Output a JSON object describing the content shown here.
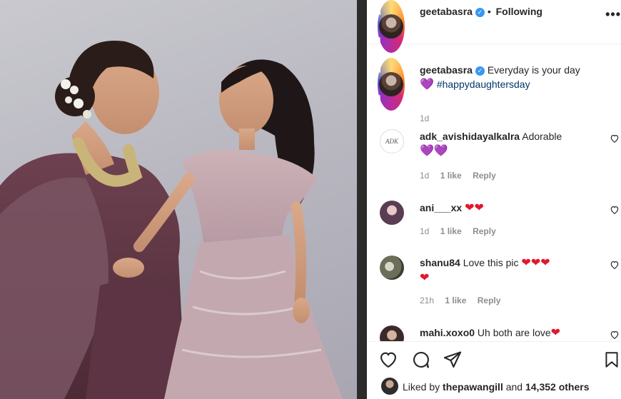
{
  "post": {
    "author": "geetabasra",
    "follow_status": "Following",
    "more_label": "•••",
    "bullet": "•",
    "verified_mark": "✓"
  },
  "caption": {
    "author": "geetabasra",
    "text": "Everyday is your day",
    "hashtag": "#happydaughtersday",
    "time": "1d",
    "emoji": "💜"
  },
  "comments": [
    {
      "author": "adk_avishidayalkalra",
      "text": "Adorable",
      "emoji": "💜💜",
      "time": "1d",
      "likes": "1 like",
      "reply": "Reply",
      "avatar_text": "ADK"
    },
    {
      "author": "ani___xx",
      "text": "",
      "emoji": "❤❤",
      "time": "1d",
      "likes": "1 like",
      "reply": "Reply"
    },
    {
      "author": "shanu84",
      "text": "Love this pic",
      "emoji": "❤❤❤",
      "emoji2": "❤",
      "time": "21h",
      "likes": "1 like",
      "reply": "Reply"
    },
    {
      "author": "mahi.xoxo0",
      "text": "Uh both are love",
      "emoji": "❤"
    }
  ],
  "likes": {
    "prefix": "Liked by",
    "user": "thepawangill",
    "and": "and",
    "count": "14,352 others"
  }
}
